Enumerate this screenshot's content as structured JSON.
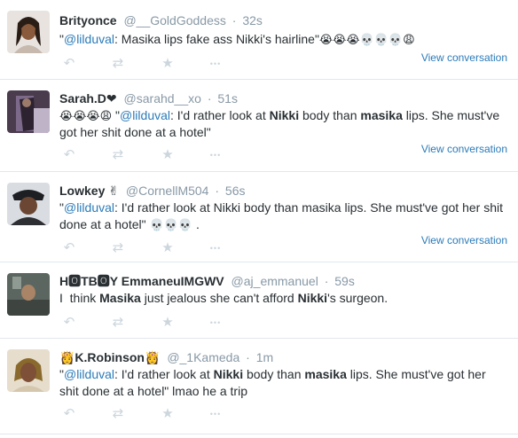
{
  "tweets": [
    {
      "fullname": "Brityonce",
      "username": "@__GoldGoddess",
      "time": "32s",
      "segments": [
        {
          "t": "\"",
          "s": "text"
        },
        {
          "t": "@lilduval",
          "s": "mention"
        },
        {
          "t": ": Masika lips fake ass Nikki's hairline\"",
          "s": "text"
        },
        {
          "t": "😭😭😭💀💀💀😩",
          "s": "emoji"
        }
      ],
      "view_conversation": "View conversation"
    },
    {
      "fullname": "Sarah.D❤",
      "username": "@sarahd__xo",
      "time": "51s",
      "segments": [
        {
          "t": "😭😭😭😩",
          "s": "emoji"
        },
        {
          "t": " \"",
          "s": "text"
        },
        {
          "t": "@lilduval",
          "s": "mention"
        },
        {
          "t": ": I'd rather look at ",
          "s": "text"
        },
        {
          "t": "Nikki",
          "s": "bold"
        },
        {
          "t": " body than ",
          "s": "text"
        },
        {
          "t": "masika",
          "s": "bold"
        },
        {
          "t": " lips. She must've got her shit done at a hotel\"",
          "s": "text"
        }
      ],
      "view_conversation": "View conversation"
    },
    {
      "fullname": "Lowkey ✌",
      "username": "@CornellM504",
      "time": "56s",
      "segments": [
        {
          "t": "\"",
          "s": "text"
        },
        {
          "t": "@lilduval",
          "s": "mention"
        },
        {
          "t": ": I'd rather look at Nikki body than masika lips. She must've got her shit done at a hotel\" ",
          "s": "text"
        },
        {
          "t": "💀💀💀",
          "s": "emoji"
        },
        {
          "t": " .",
          "s": "text"
        }
      ],
      "view_conversation": "View conversation"
    },
    {
      "fullname": "H🅾TB🅾Y EmmaneuIMGWV",
      "username": "@aj_emmanuel",
      "time": "59s",
      "segments": [
        {
          "t": "I  think ",
          "s": "text"
        },
        {
          "t": "Masika",
          "s": "bold"
        },
        {
          "t": " just jealous she can't afford ",
          "s": "text"
        },
        {
          "t": "Nikki",
          "s": "bold"
        },
        {
          "t": "'s surgeon.",
          "s": "text"
        }
      ],
      "view_conversation": ""
    },
    {
      "fullname": "👸K.Robinson👸",
      "username": "@_1Kameda",
      "time": "1m",
      "segments": [
        {
          "t": "\"",
          "s": "text"
        },
        {
          "t": "@lilduval",
          "s": "mention"
        },
        {
          "t": ": I'd rather look at ",
          "s": "text"
        },
        {
          "t": "Nikki",
          "s": "bold"
        },
        {
          "t": " body than ",
          "s": "text"
        },
        {
          "t": "masika",
          "s": "bold"
        },
        {
          "t": " lips. She must've got her shit done at a hotel\" lmao he a trip",
          "s": "text"
        }
      ],
      "view_conversation": ""
    }
  ],
  "actions": [
    {
      "name": "reply-icon",
      "glyph": "↶"
    },
    {
      "name": "retweet-icon",
      "glyph": "⇄"
    },
    {
      "name": "favorite-icon",
      "glyph": "★"
    },
    {
      "name": "more-icon",
      "glyph": "•••"
    }
  ],
  "colors": {
    "link": "#2b7bb9",
    "meta": "#8899a6",
    "action": "#ccd6dd",
    "divider": "#e1e8ed"
  }
}
